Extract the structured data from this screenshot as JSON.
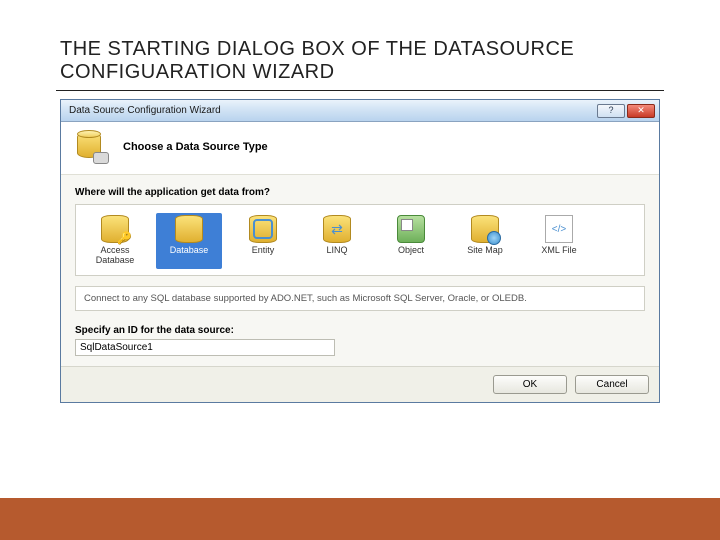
{
  "slide": {
    "heading": "THE STARTING DIALOG BOX OF THE DATASOURCE CONFIGUARATION WIZARD"
  },
  "dialog": {
    "title": "Data Source Configuration Wizard",
    "help_label": "?",
    "close_label": "✕",
    "header": "Choose a Data Source Type",
    "prompt": "Where will the application get data from?",
    "options": [
      {
        "label": "Access Database",
        "selected": false
      },
      {
        "label": "Database",
        "selected": true
      },
      {
        "label": "Entity",
        "selected": false
      },
      {
        "label": "LINQ",
        "selected": false
      },
      {
        "label": "Object",
        "selected": false
      },
      {
        "label": "Site Map",
        "selected": false
      },
      {
        "label": "XML File",
        "selected": false
      }
    ],
    "description": "Connect to any SQL database supported by ADO.NET, such as Microsoft SQL Server, Oracle, or OLEDB.",
    "id_prompt": "Specify an ID for the data source:",
    "id_value": "SqlDataSource1",
    "ok_label": "OK",
    "cancel_label": "Cancel"
  }
}
